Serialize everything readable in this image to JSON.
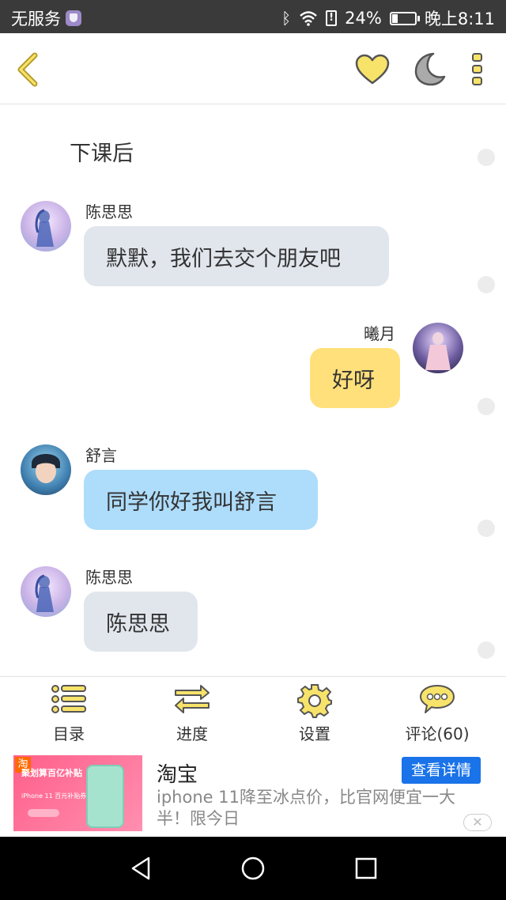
{
  "status_bar": {
    "carrier": "无服务",
    "battery_percent": "24%",
    "battery_level": 0.24,
    "time": "晚上8:11"
  },
  "header": {
    "back_icon": "chevron-left-icon",
    "heart_icon": "heart-icon",
    "night_mode_icon": "moon-icon",
    "more_icon": "more-vertical-icon"
  },
  "chat": {
    "chapter_title": "下课后",
    "messages": [
      {
        "sender": "陈思思",
        "text": "默默，我们去交个朋友吧",
        "side": "left",
        "bubble_color": "#e1e6ed"
      },
      {
        "sender": "曦月",
        "text": "好呀",
        "side": "right",
        "bubble_color": "#ffe07a"
      },
      {
        "sender": "舒言",
        "text": "同学你好我叫舒言",
        "side": "left",
        "bubble_color": "#aedcfb"
      },
      {
        "sender": "陈思思",
        "text": "陈思思",
        "side": "left",
        "bubble_color": "#e1e6ed"
      }
    ]
  },
  "bottom_nav": {
    "items": [
      {
        "label": "目录",
        "icon": "list-icon"
      },
      {
        "label": "进度",
        "icon": "swap-arrows-icon"
      },
      {
        "label": "设置",
        "icon": "gear-icon"
      },
      {
        "label": "评论(60)",
        "icon": "comment-icon"
      }
    ]
  },
  "ad": {
    "image_badge": "淘",
    "image_promo": "聚划算百亿补贴",
    "image_sub": "iPhone 11 百元补贴券",
    "title": "淘宝",
    "description": "iphone 11降至冰点价，比官网便宜一大半！限今日",
    "cta_label": "查看详情",
    "close_label": "✕"
  },
  "colors": {
    "accent_yellow": "#f7e36a",
    "icon_stroke": "#b59a2a",
    "status_bar_bg": "#3a3a3a"
  }
}
